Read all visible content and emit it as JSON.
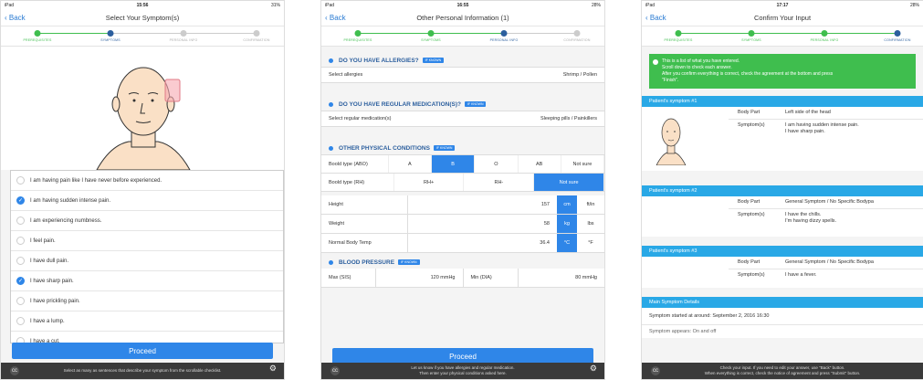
{
  "statusbar": {
    "s1": {
      "carrier": "iPad",
      "time": "15:56",
      "battery": "31%"
    },
    "s2": {
      "carrier": "iPad",
      "time": "16:55",
      "battery": "28%"
    },
    "s3": {
      "carrier": "iPad",
      "time": "17:17",
      "battery": "28%"
    }
  },
  "nav": {
    "back": "Back",
    "s1_title": "Select Your Symptom(s)",
    "s2_title": "Other Personal Information (1)",
    "s3_title": "Confirm Your Input"
  },
  "steps": [
    "PREREQUISITES",
    "SYMPTOMS",
    "PERSONAL INFO",
    "CONFIRMATION"
  ],
  "s1": {
    "checklist": [
      {
        "text": "I am having pain like I have never before experienced.",
        "checked": false
      },
      {
        "text": "I am having sudden intense pain.",
        "checked": true
      },
      {
        "text": "I am experiencing numbness.",
        "checked": false
      },
      {
        "text": "I feel pain.",
        "checked": false
      },
      {
        "text": "I have dull pain.",
        "checked": false
      },
      {
        "text": "I have sharp pain.",
        "checked": true
      },
      {
        "text": "I have prickling pain.",
        "checked": false
      },
      {
        "text": "I have a lump.",
        "checked": false
      },
      {
        "text": "I have a cut.",
        "checked": false
      }
    ],
    "proceed": "Proceed",
    "hint": "Select as many as sentences that describe your symptom from the scrollable checklist."
  },
  "s2": {
    "allergies_title": "DO YOU HAVE ALLERGIES?",
    "if_known": "IF KNOWN",
    "allergies_label": "Select allergies",
    "allergies_value": "Shrimp / Pollen",
    "medication_title": "DO YOU HAVE REGULAR MEDICATION(S)?",
    "medication_label": "Select regular medication(s)",
    "medication_value": "Sleeping pills / Painkillers",
    "physical_title": "OTHER PHYSICAL CONDITIONS",
    "blood_abo_label": "Boold type (ABO)",
    "abo_options": [
      "A",
      "B",
      "O",
      "AB",
      "Not sure"
    ],
    "blood_rh_label": "Boold type (RH)",
    "rh_options": [
      "RH+",
      "RH-",
      "Not sure"
    ],
    "height_label": "Height",
    "height_value": "157",
    "height_unit_on": "cm",
    "height_unit_off": "ft/in",
    "weight_label": "Weight",
    "weight_value": "58",
    "weight_unit_on": "kg",
    "weight_unit_off": "lbs",
    "temp_label": "Normal Body Temp",
    "temp_value": "36.4",
    "temp_unit_on": "°C",
    "temp_unit_off": "°F",
    "bp_title": "BLOOD PRESSURE",
    "bp_max_label": "Max (SIS)",
    "bp_max_value": "120 mmHg",
    "bp_min_label": "Min (DIA)",
    "bp_min_value": "80 mmHg",
    "proceed": "Proceed",
    "hint1": "Let us know if you have allergies and regular medication.",
    "hint2": "Then enter your physical conditions asked here."
  },
  "s3": {
    "info1": "This is a list of what you have entered.",
    "info2": "Scroll down to check each answer.",
    "info3": "After you confirm everything is correct, check the agreement at the bottom and press",
    "info4": "\"Finish\".",
    "sym1_head": "Patient's symptom #1",
    "body_part": "Body Part",
    "symptoms": "Symptom(s)",
    "sym1_part": "Left side of the head",
    "sym1_s1": "I am having sudden intense pain.",
    "sym1_s2": "I have sharp pain.",
    "sym2_head": "Patient's symptom #2",
    "sym2_part": "General Symptom / No Specific Bodypa",
    "sym2_s1": "I have the chills.",
    "sym2_s2": "I'm having dizzy spells.",
    "sym3_head": "Patient's symptom #3",
    "sym3_part": "General Symptom / No Specific Bodypa",
    "sym3_s1": "I have a fever.",
    "main_head": "Main Symptom Details",
    "started": "Symptom started at around: September 2, 2016 16:30",
    "cut_text": "Symptom appears: On and off",
    "hint1": "Check your input. If you need to edit your answer, use \"Back\" button.",
    "hint2": "When everything is correct, check the notice of agreement and press \"Submit\" button."
  },
  "colors": {
    "accent": "#2f86e8",
    "done": "#3fbe4e",
    "header_blue": "#29a8e6"
  },
  "license_icon": "cc-icon"
}
